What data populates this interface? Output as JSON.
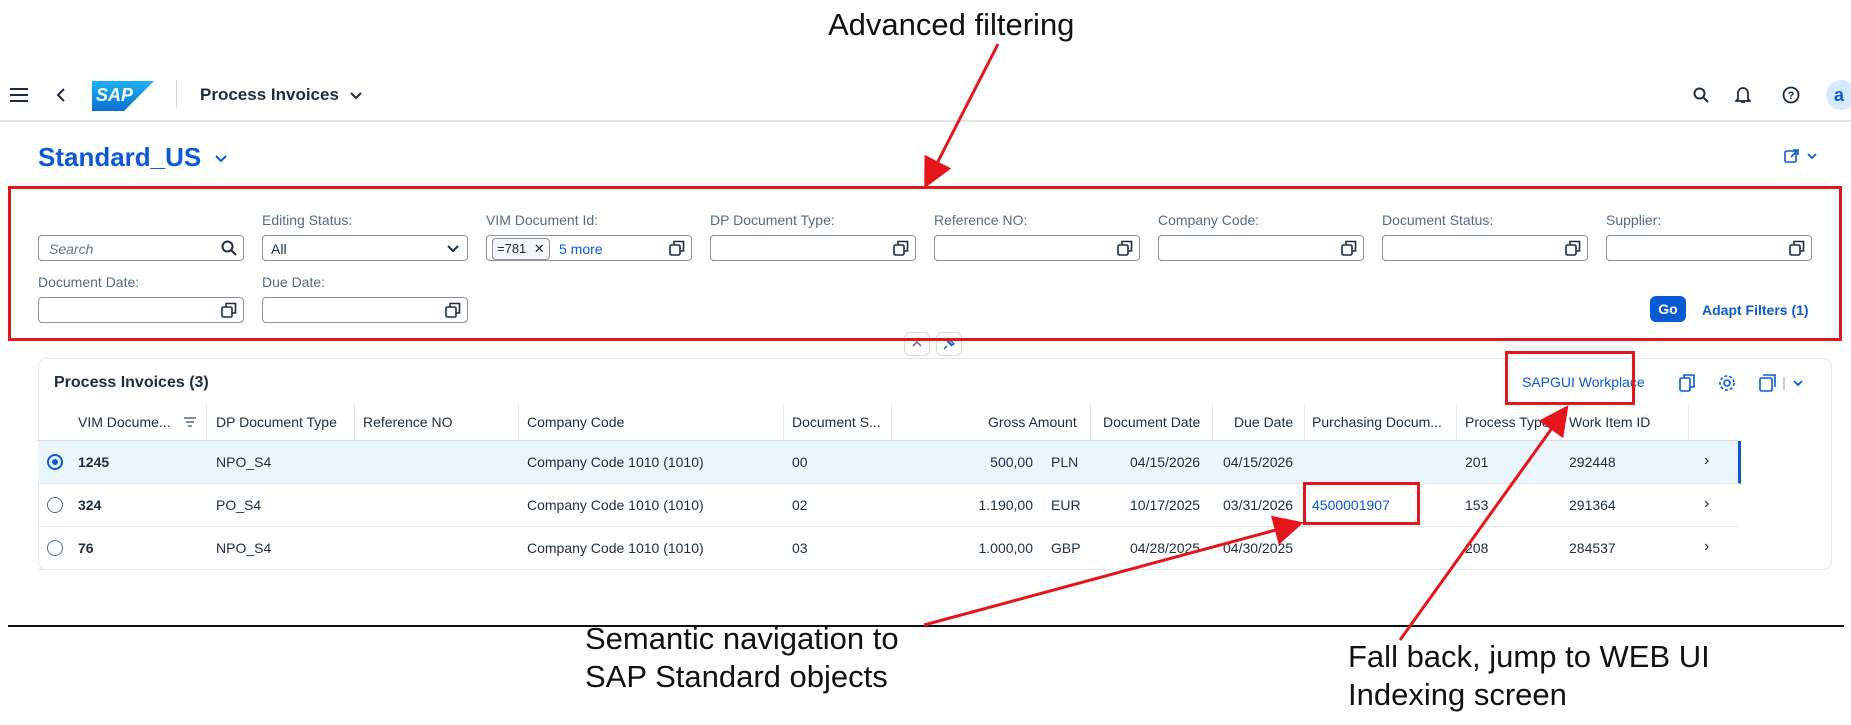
{
  "callouts": {
    "advanced_filtering": "Advanced filtering",
    "semantic_nav_line1": "Semantic navigation to",
    "semantic_nav_line2": "SAP Standard objects",
    "fallback_line1": "Fall back, jump to WEB UI",
    "fallback_line2": "Indexing screen"
  },
  "shell": {
    "title": "Process Invoices",
    "logo_text": "SAP",
    "avatar_letter": "a",
    "icons": [
      "menu-icon",
      "back-icon",
      "search-icon",
      "bell-icon",
      "help-icon"
    ]
  },
  "variant": {
    "name": "Standard_US"
  },
  "filters": {
    "search_placeholder": "Search",
    "editing_status_label": "Editing Status:",
    "editing_status_value": "All",
    "vim_doc_label": "VIM Document Id:",
    "vim_doc_token": "=781",
    "vim_doc_more": "5 more",
    "dp_doc_type_label": "DP Document Type:",
    "reference_no_label": "Reference NO:",
    "company_code_label": "Company Code:",
    "document_status_label": "Document Status:",
    "supplier_label": "Supplier:",
    "document_date_label": "Document Date:",
    "due_date_label": "Due Date:",
    "go_label": "Go",
    "adapt_label": "Adapt Filters (1)"
  },
  "table": {
    "title": "Process Invoices (3)",
    "sapgui_label": "SAPGUI Workplace",
    "headers": [
      "VIM Docume...",
      "DP Document Type",
      "Reference NO",
      "Company Code",
      "Document S...",
      "Gross Amount",
      "Document Date",
      "Due Date",
      "Purchasing Docum...",
      "Process Type",
      "Work Item ID"
    ],
    "rows": [
      {
        "vim": "1245",
        "dp_type": "NPO_S4",
        "ref": "",
        "company": "Company Code 1010 (1010)",
        "status": "00",
        "amount": "500,00",
        "currency": "PLN",
        "doc_date": "04/15/2026",
        "due_date": "04/15/2026",
        "po": "",
        "process_type": "201",
        "work_item": "292448",
        "selected": true
      },
      {
        "vim": "324",
        "dp_type": "PO_S4",
        "ref": "",
        "company": "Company Code 1010 (1010)",
        "status": "02",
        "amount": "1.190,00",
        "currency": "EUR",
        "doc_date": "10/17/2025",
        "due_date": "03/31/2026",
        "po": "4500001907",
        "process_type": "153",
        "work_item": "291364",
        "selected": false
      },
      {
        "vim": "76",
        "dp_type": "NPO_S4",
        "ref": "",
        "company": "Company Code 1010 (1010)",
        "status": "03",
        "amount": "1.000,00",
        "currency": "GBP",
        "doc_date": "04/28/2025",
        "due_date": "04/30/2025",
        "po": "",
        "process_type": "208",
        "work_item": "284537",
        "selected": false
      }
    ]
  },
  "colors": {
    "accent": "#0a5ad6",
    "annotation": "#e4161b"
  }
}
